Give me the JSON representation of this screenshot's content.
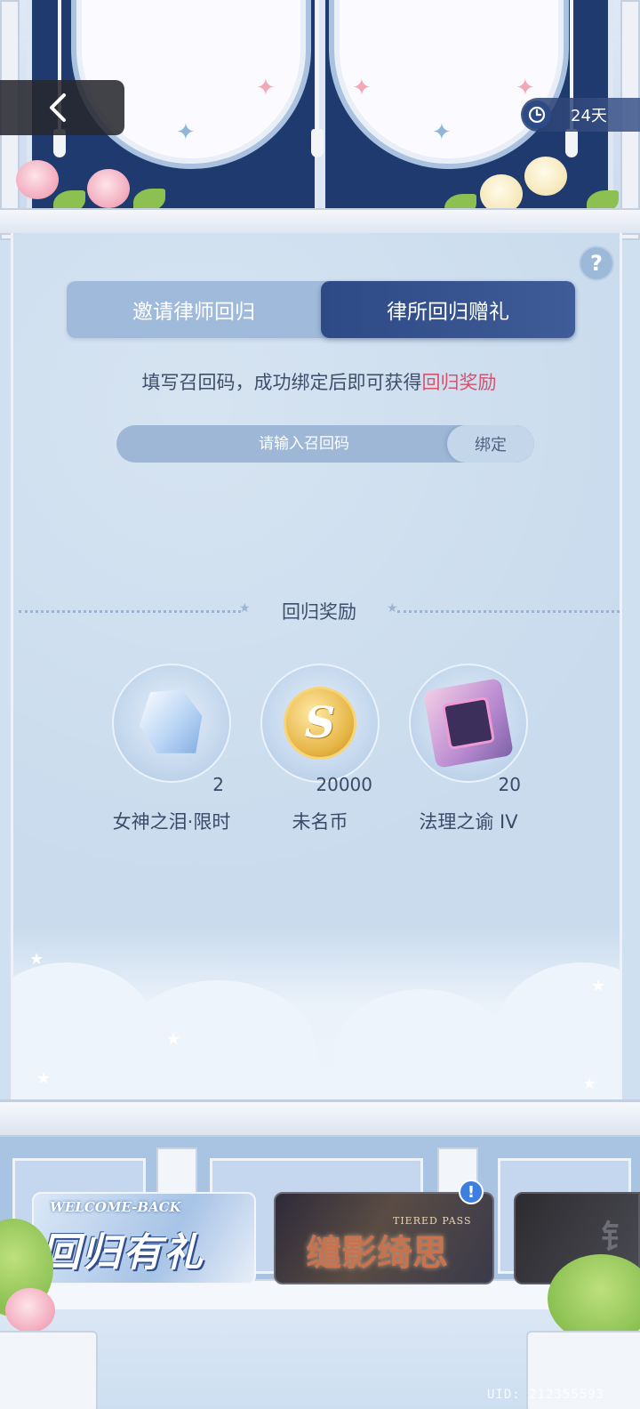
{
  "header": {
    "timer_text": "24天"
  },
  "tabs": [
    {
      "label": "邀请律师回归",
      "active": false
    },
    {
      "label": "律所回归赠礼",
      "active": true
    }
  ],
  "hint": {
    "prefix": "填写召回码，成功绑定后即可获得",
    "highlight": "回归奖励"
  },
  "code_form": {
    "placeholder": "请输入召回码",
    "bind_label": "绑定"
  },
  "rewards_section": {
    "title": "回归奖励",
    "items": [
      {
        "name": "女神之泪·限时",
        "quantity": "2",
        "icon": "gem-icon"
      },
      {
        "name": "未名币",
        "quantity": "20000",
        "icon": "coin-icon"
      },
      {
        "name": "法理之谕 IV",
        "quantity": "20",
        "icon": "chip-icon"
      }
    ]
  },
  "banners": {
    "welcome": {
      "small": "WELCOME-BACK",
      "big": "回归有礼"
    },
    "tiered": {
      "small": "TIERED PASS",
      "big": "缱影绮思"
    },
    "third": {
      "big": "钅"
    }
  },
  "footer": {
    "uid": "UID: 212355593"
  },
  "colors": {
    "accent_dark_blue": "#2d4a86",
    "highlight_pink": "#d6516d",
    "panel_bg": "#c9dbed"
  }
}
